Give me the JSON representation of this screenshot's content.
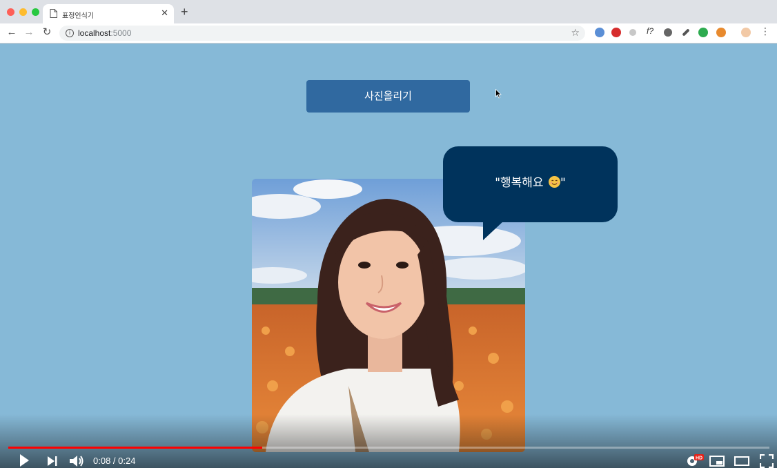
{
  "browser": {
    "tab_title": "표정인식기",
    "url_host": "localhost",
    "url_port": ":5000",
    "extension_text": "f?"
  },
  "page": {
    "upload_button_label": "사진올리기",
    "emotion_text": "\"행복해요",
    "emotion_close_quote": "\"",
    "emotion_icon": "smiling-face-emoji"
  },
  "player": {
    "current_time": "0:08",
    "time_separator": " / ",
    "duration": "0:24",
    "progress_fraction": 0.3333,
    "hd_badge": "HD"
  },
  "colors": {
    "page_background": "#86b9d7",
    "upload_button": "#3069a0",
    "bubble": "#00335c",
    "progress": "#ff0000"
  }
}
